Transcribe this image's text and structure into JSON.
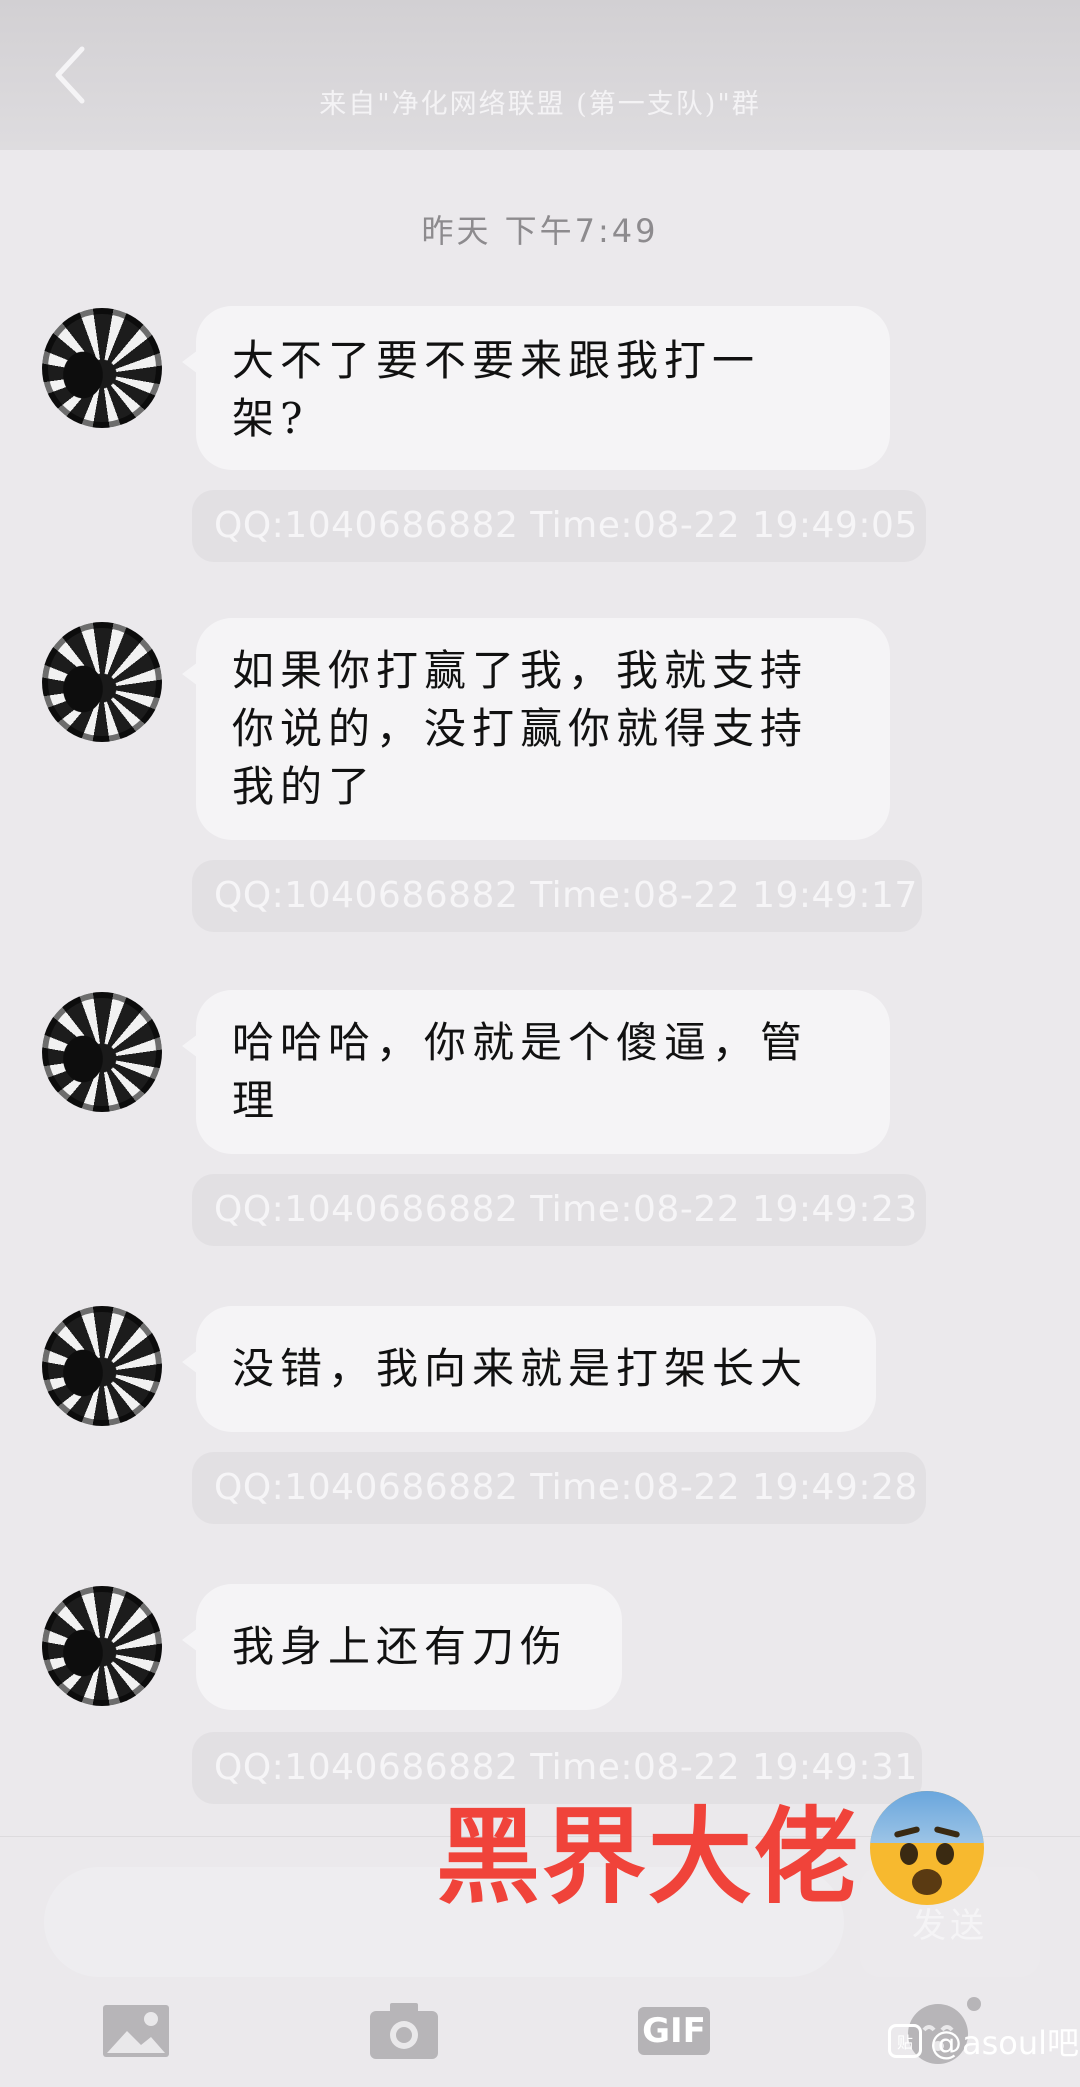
{
  "header": {
    "title": "来自\"净化网络联盟 (第一支队)\"群"
  },
  "timestamp": "昨天 下午7:49",
  "messages": [
    {
      "lines": [
        "大不了要不要来跟我打一",
        "架?"
      ],
      "meta": "QQ:1040686882  Time:08-22 19:49:05"
    },
    {
      "lines": [
        "如果你打赢了我，我就支持",
        "你说的，没打赢你就得支持",
        "我的了"
      ],
      "meta": "QQ:1040686882  Time:08-22 19:49:17"
    },
    {
      "lines": [
        "哈哈哈，你就是个傻逼，管",
        "理"
      ],
      "meta": "QQ:1040686882  Time:08-22 19:49:23"
    },
    {
      "lines": [
        "没错，我向来就是打架长大"
      ],
      "meta": "QQ:1040686882  Time:08-22 19:49:28"
    },
    {
      "lines": [
        "我身上还有刀伤"
      ],
      "meta": "QQ:1040686882  Time:08-22 19:49:31"
    }
  ],
  "overlay": {
    "caption": "黑界大佬",
    "emoji": "anxious-face-emoji"
  },
  "input": {
    "send_label": "发送"
  },
  "toolbar": {
    "gif_label": "GIF",
    "icons": [
      "image-icon",
      "camera-icon",
      "gif-icon",
      "emoji-icon"
    ]
  },
  "watermark": {
    "logo": "贴",
    "text": "@asoul吧"
  },
  "colors": {
    "background": "#ebe9ec",
    "bubble": "#f5f4f6",
    "caption": "#f0433a"
  }
}
